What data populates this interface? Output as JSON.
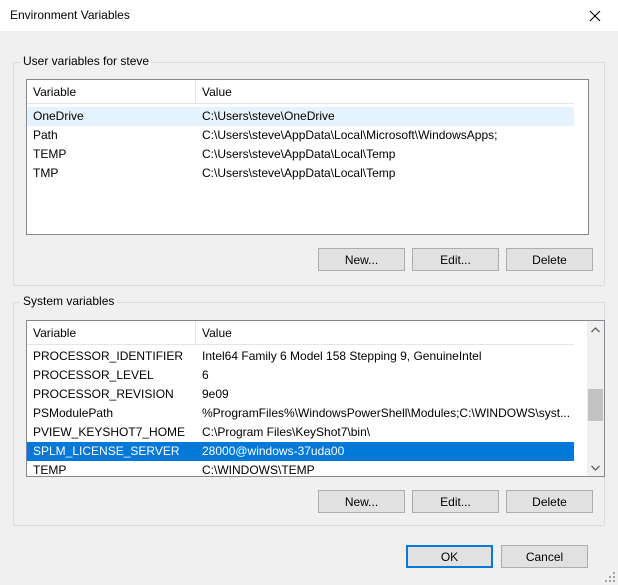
{
  "window": {
    "title": "Environment Variables"
  },
  "user_vars": {
    "legend": "User variables for steve",
    "columns": [
      "Variable",
      "Value"
    ],
    "rows": [
      {
        "var": "OneDrive",
        "value": "C:\\Users\\steve\\OneDrive"
      },
      {
        "var": "Path",
        "value": "C:\\Users\\steve\\AppData\\Local\\Microsoft\\WindowsApps;"
      },
      {
        "var": "TEMP",
        "value": "C:\\Users\\steve\\AppData\\Local\\Temp"
      },
      {
        "var": "TMP",
        "value": "C:\\Users\\steve\\AppData\\Local\\Temp"
      }
    ],
    "hovered_row": 0,
    "buttons": {
      "new": "New...",
      "edit": "Edit...",
      "delete": "Delete"
    }
  },
  "system_vars": {
    "legend": "System variables",
    "columns": [
      "Variable",
      "Value"
    ],
    "rows": [
      {
        "var": "PROCESSOR_IDENTIFIER",
        "value": "Intel64 Family 6 Model 158 Stepping 9, GenuineIntel"
      },
      {
        "var": "PROCESSOR_LEVEL",
        "value": "6"
      },
      {
        "var": "PROCESSOR_REVISION",
        "value": "9e09"
      },
      {
        "var": "PSModulePath",
        "value": "%ProgramFiles%\\WindowsPowerShell\\Modules;C:\\WINDOWS\\syst..."
      },
      {
        "var": "PVIEW_KEYSHOT7_HOME",
        "value": "C:\\Program Files\\KeyShot7\\bin\\"
      },
      {
        "var": "SPLM_LICENSE_SERVER",
        "value": "28000@windows-37uda00"
      },
      {
        "var": "TEMP",
        "value": "C:\\WINDOWS\\TEMP"
      }
    ],
    "selected_row": 5,
    "buttons": {
      "new": "New...",
      "edit": "Edit...",
      "delete": "Delete"
    }
  },
  "footer": {
    "ok": "OK",
    "cancel": "Cancel"
  },
  "icons": {
    "close": "close-icon",
    "scroll_up": "chevron-up-icon",
    "scroll_down": "chevron-down-icon"
  },
  "colors": {
    "selection": "#0078d7",
    "hover": "#e5f3ff",
    "default_button_border": "#0078d7"
  }
}
